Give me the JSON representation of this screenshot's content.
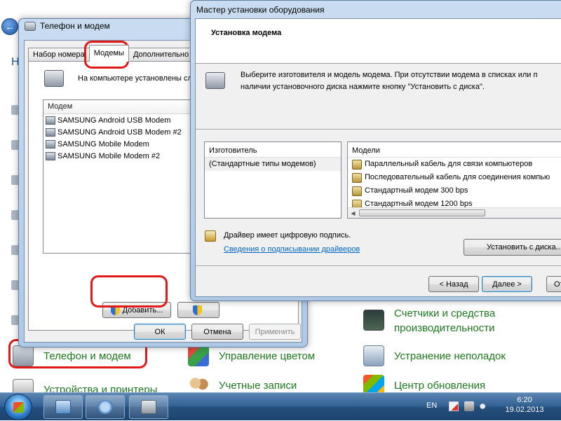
{
  "control_panel": {
    "heading_fragment": "Н",
    "items": [
      {
        "label_lines": [
          "Телефон и модем"
        ]
      },
      {
        "label_lines": [
          "Управление цветом"
        ]
      },
      {
        "label_lines": [
          "Учетные записи"
        ]
      },
      {
        "label_lines": [
          "Устройства и принтеры"
        ]
      },
      {
        "label_lines": [
          "Счетчики и средства",
          "производительности"
        ]
      },
      {
        "label_lines": [
          "Устранение неполадок"
        ]
      },
      {
        "label_lines": [
          "Центр обновления"
        ]
      }
    ]
  },
  "phone_modem_window": {
    "title": "Телефон и модем",
    "tabs": [
      "Набор номера",
      "Модемы",
      "Дополнительно"
    ],
    "active_tab": 1,
    "info_text": "На компьютере установлены сле",
    "list_header": "Модем",
    "modems": [
      "SAMSUNG Android USB Modem",
      "SAMSUNG Android USB Modem #2",
      "SAMSUNG Mobile Modem",
      "SAMSUNG Mobile Modem #2"
    ],
    "add_button": "Добавить...",
    "ok_button": "ОК",
    "cancel_button": "Отмена",
    "apply_button": "Применить"
  },
  "wizard_window": {
    "title": "Мастер установки оборудования",
    "header_title": "Установка модема",
    "description_line1": "Выберите изготовителя и модель модема. При отсутствии модема в списках или п",
    "description_line2": "наличии установочного диска нажмите кнопку \"Установить с диска\".",
    "manufacturer_header": "Изготовитель",
    "manufacturers": [
      "(Стандартные типы модемов)"
    ],
    "models_header": "Модели",
    "models": [
      "Параллельный кабель для связи компьютеров",
      "Последовательный кабель для соединения компью",
      "Стандартный модем   300 bps",
      "Стандартный модем  1200 bps"
    ],
    "signed_text": "Драйвер имеет цифровую подпись.",
    "signing_link": "Сведения о подписывании драйверов",
    "have_disk_button": "Установить с диска...",
    "back_button": "< Назад",
    "next_button": "Далее >",
    "cancel_button_fragment": "От"
  },
  "taskbar": {
    "language": "EN",
    "time": "6:20",
    "date": "19.02.2013"
  },
  "colors": {
    "link_green": "#1c7a1c",
    "highlight_red": "#e11919",
    "link_blue": "#0066cc"
  }
}
